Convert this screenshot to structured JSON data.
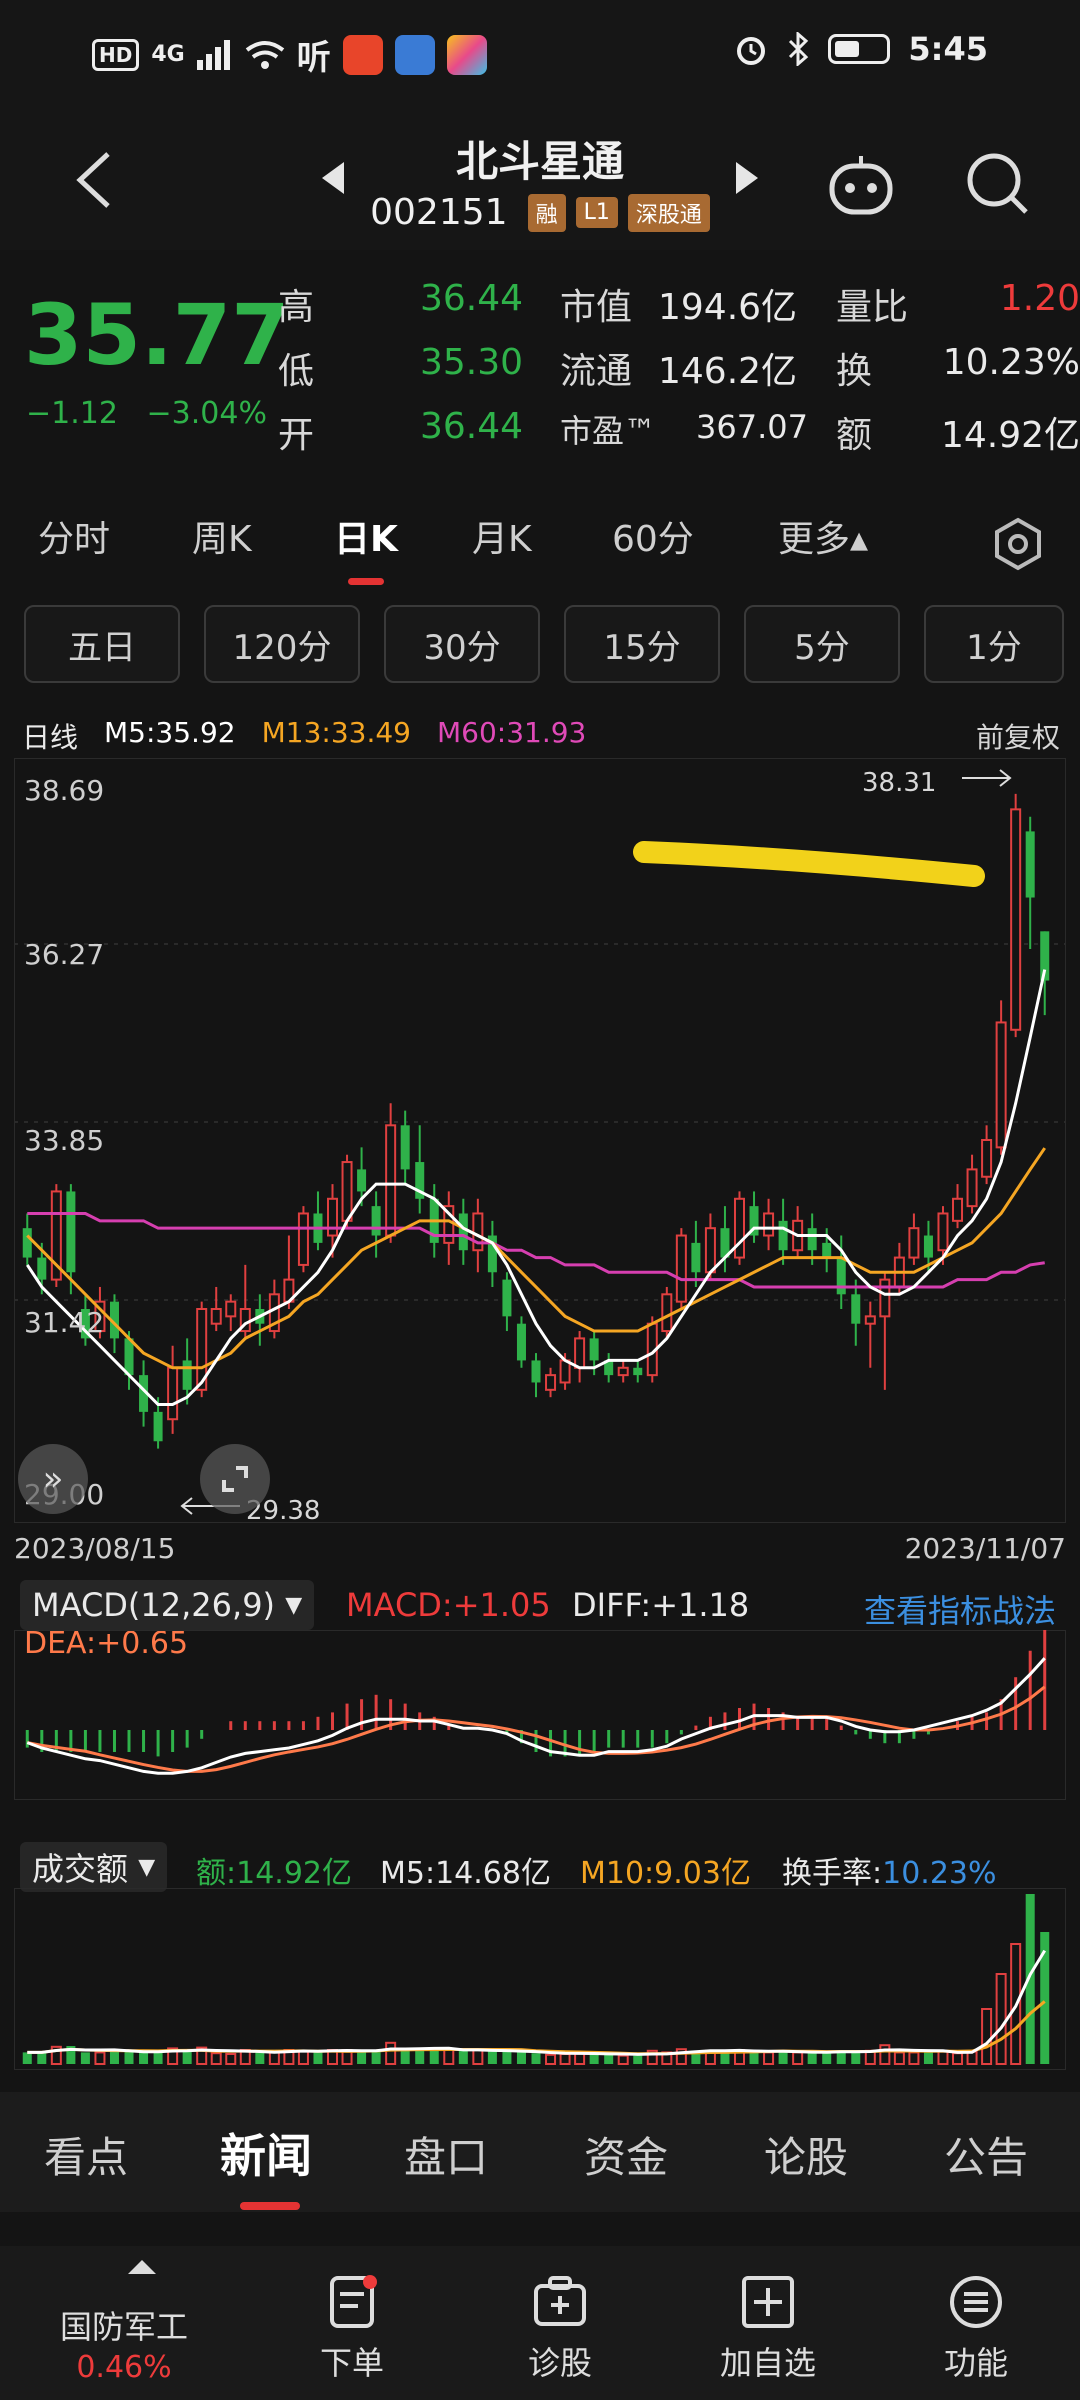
{
  "status": {
    "time": "5:45",
    "hd": "HD",
    "net": "4G",
    "app_hear": "听"
  },
  "header": {
    "title": "北斗星通",
    "code": "002151",
    "tags": [
      "融",
      "L1",
      "深股通"
    ]
  },
  "quote": {
    "price": "35.77",
    "change": "−1.12",
    "change_pct": "−3.04%",
    "rows": [
      {
        "l1": "高",
        "v1": "36.44",
        "l2": "市值",
        "v2": "194.6亿",
        "l3": "量比",
        "v3": "1.20"
      },
      {
        "l1": "低",
        "v1": "35.30",
        "l2": "流通",
        "v2": "146.2亿",
        "l3": "换",
        "v3": "10.23%"
      },
      {
        "l1": "开",
        "v1": "36.44",
        "l2": "市盈™",
        "v2": "367.07",
        "l3": "额",
        "v3": "14.92亿"
      }
    ]
  },
  "ktabs": [
    "分时",
    "周K",
    "日K",
    "月K",
    "60分",
    "更多▴"
  ],
  "mtabs": [
    "五日",
    "120分",
    "30分",
    "15分",
    "5分",
    "1分"
  ],
  "ma": {
    "label": "日线",
    "m5": "M5:35.92",
    "m13": "M13:33.49",
    "m60": "M60:31.93",
    "adjust": "前复权"
  },
  "chart_data": {
    "type": "candlestick",
    "y_ticks": [
      "38.69",
      "36.27",
      "33.85",
      "31.42",
      "29.00"
    ],
    "ylim": [
      29.0,
      38.69
    ],
    "date_start": "2023/08/15",
    "date_end": "2023/11/07",
    "annot_high": "38.31",
    "annot_low": "29.38",
    "colors": {
      "up": "#e04040",
      "down": "#2fb24a",
      "m5": "#ffffff",
      "m13": "#f5a623",
      "m60": "#d63fb0",
      "highlight": "#f2d21a"
    },
    "candles": [
      [
        32.4,
        32.0,
        32.6,
        31.9
      ],
      [
        32.0,
        31.7,
        32.2,
        31.5
      ],
      [
        31.7,
        32.9,
        33.0,
        31.6
      ],
      [
        32.9,
        31.8,
        33.0,
        31.5
      ],
      [
        31.3,
        30.9,
        31.5,
        30.8
      ],
      [
        31.0,
        31.4,
        31.6,
        30.9
      ],
      [
        31.4,
        30.9,
        31.5,
        30.7
      ],
      [
        30.9,
        30.4,
        31.0,
        30.2
      ],
      [
        30.4,
        29.9,
        30.6,
        29.7
      ],
      [
        29.9,
        29.5,
        30.1,
        29.4
      ],
      [
        29.8,
        30.5,
        30.8,
        29.6
      ],
      [
        30.6,
        30.2,
        30.9,
        30.0
      ],
      [
        30.2,
        31.3,
        31.4,
        30.1
      ],
      [
        31.1,
        31.3,
        31.6,
        31.0
      ],
      [
        31.2,
        31.4,
        31.5,
        31.0
      ],
      [
        31.0,
        31.3,
        31.9,
        30.9
      ],
      [
        31.3,
        31.1,
        31.5,
        30.8
      ],
      [
        31.0,
        31.5,
        31.7,
        30.9
      ],
      [
        31.4,
        31.7,
        32.3,
        31.3
      ],
      [
        31.9,
        32.6,
        32.7,
        31.8
      ],
      [
        32.6,
        32.2,
        32.9,
        32.1
      ],
      [
        32.3,
        32.8,
        33.0,
        32.0
      ],
      [
        32.5,
        33.3,
        33.4,
        32.4
      ],
      [
        33.2,
        32.9,
        33.5,
        32.7
      ],
      [
        32.7,
        32.3,
        32.9,
        32.0
      ],
      [
        32.3,
        33.8,
        34.1,
        32.2
      ],
      [
        33.8,
        33.2,
        34.0,
        33.0
      ],
      [
        33.3,
        32.8,
        33.8,
        32.6
      ],
      [
        32.8,
        32.2,
        33.0,
        32.0
      ],
      [
        32.2,
        32.7,
        32.9,
        31.9
      ],
      [
        32.6,
        32.1,
        32.8,
        31.9
      ],
      [
        32.1,
        32.6,
        32.8,
        31.8
      ],
      [
        32.3,
        31.8,
        32.5,
        31.6
      ],
      [
        31.7,
        31.2,
        31.8,
        31.0
      ],
      [
        31.1,
        30.6,
        31.2,
        30.5
      ],
      [
        30.6,
        30.3,
        30.7,
        30.1
      ],
      [
        30.2,
        30.4,
        30.5,
        30.1
      ],
      [
        30.3,
        30.6,
        30.7,
        30.2
      ],
      [
        30.5,
        30.9,
        31.0,
        30.3
      ],
      [
        30.9,
        30.6,
        31.0,
        30.4
      ],
      [
        30.6,
        30.4,
        30.7,
        30.3
      ],
      [
        30.4,
        30.5,
        30.6,
        30.3
      ],
      [
        30.5,
        30.4,
        30.6,
        30.3
      ],
      [
        30.4,
        31.1,
        31.2,
        30.3
      ],
      [
        31.0,
        31.5,
        31.6,
        30.9
      ],
      [
        31.4,
        32.3,
        32.4,
        31.3
      ],
      [
        32.2,
        31.8,
        32.5,
        31.6
      ],
      [
        31.8,
        32.4,
        32.6,
        31.7
      ],
      [
        32.4,
        32.0,
        32.7,
        31.8
      ],
      [
        32.0,
        32.8,
        32.9,
        31.9
      ],
      [
        32.7,
        32.3,
        32.9,
        32.2
      ],
      [
        32.3,
        32.6,
        32.8,
        32.1
      ],
      [
        32.5,
        32.1,
        32.8,
        31.9
      ],
      [
        32.1,
        32.5,
        32.7,
        32.0
      ],
      [
        32.4,
        32.1,
        32.6,
        31.9
      ],
      [
        32.2,
        32.0,
        32.4,
        31.8
      ],
      [
        32.0,
        31.5,
        32.3,
        31.3
      ],
      [
        31.5,
        31.1,
        31.7,
        30.8
      ],
      [
        31.1,
        31.2,
        31.4,
        30.5
      ],
      [
        31.2,
        31.7,
        31.8,
        30.2
      ],
      [
        31.6,
        32.0,
        32.2,
        31.5
      ],
      [
        32.0,
        32.4,
        32.6,
        31.9
      ],
      [
        32.3,
        32.0,
        32.5,
        31.8
      ],
      [
        32.1,
        32.6,
        32.7,
        31.9
      ],
      [
        32.5,
        32.8,
        33.0,
        32.4
      ],
      [
        32.7,
        33.2,
        33.4,
        32.6
      ],
      [
        33.1,
        33.6,
        33.8,
        33.0
      ],
      [
        33.5,
        35.2,
        35.5,
        33.4
      ],
      [
        35.1,
        38.1,
        38.31,
        35.0
      ],
      [
        37.8,
        36.9,
        38.0,
        36.2
      ],
      [
        36.44,
        35.77,
        36.44,
        35.3
      ]
    ],
    "m5": [
      31.9,
      31.6,
      31.4,
      31.2,
      31.0,
      30.8,
      30.6,
      30.4,
      30.2,
      30.0,
      30.0,
      30.1,
      30.3,
      30.6,
      30.9,
      31.1,
      31.2,
      31.3,
      31.4,
      31.6,
      31.8,
      32.1,
      32.5,
      32.8,
      33.0,
      33.0,
      33.0,
      32.9,
      32.8,
      32.6,
      32.4,
      32.3,
      32.2,
      31.9,
      31.5,
      31.1,
      30.8,
      30.6,
      30.5,
      30.5,
      30.6,
      30.6,
      30.6,
      30.7,
      30.9,
      31.2,
      31.5,
      31.8,
      32.0,
      32.2,
      32.4,
      32.4,
      32.4,
      32.3,
      32.3,
      32.3,
      32.1,
      31.8,
      31.6,
      31.5,
      31.5,
      31.6,
      31.8,
      32.0,
      32.3,
      32.5,
      32.8,
      33.3,
      34.1,
      35.0,
      35.92
    ],
    "m13": [
      32.3,
      32.1,
      31.9,
      31.7,
      31.5,
      31.3,
      31.1,
      30.9,
      30.7,
      30.6,
      30.5,
      30.5,
      30.5,
      30.6,
      30.7,
      30.9,
      31.0,
      31.1,
      31.2,
      31.4,
      31.5,
      31.7,
      31.9,
      32.1,
      32.2,
      32.3,
      32.4,
      32.5,
      32.5,
      32.5,
      32.4,
      32.3,
      32.2,
      32.0,
      31.8,
      31.6,
      31.4,
      31.2,
      31.1,
      31.0,
      31.0,
      31.0,
      31.0,
      31.1,
      31.2,
      31.3,
      31.4,
      31.5,
      31.6,
      31.7,
      31.8,
      31.9,
      32.0,
      32.0,
      32.0,
      32.0,
      32.0,
      31.9,
      31.8,
      31.8,
      31.8,
      31.8,
      31.9,
      32.0,
      32.1,
      32.2,
      32.4,
      32.6,
      32.9,
      33.2,
      33.49
    ],
    "m60": [
      32.6,
      32.6,
      32.6,
      32.6,
      32.6,
      32.5,
      32.5,
      32.5,
      32.5,
      32.4,
      32.4,
      32.4,
      32.4,
      32.4,
      32.4,
      32.4,
      32.4,
      32.4,
      32.4,
      32.4,
      32.4,
      32.4,
      32.4,
      32.4,
      32.4,
      32.4,
      32.4,
      32.4,
      32.3,
      32.3,
      32.3,
      32.2,
      32.2,
      32.1,
      32.1,
      32.0,
      32.0,
      31.9,
      31.9,
      31.9,
      31.8,
      31.8,
      31.8,
      31.8,
      31.8,
      31.7,
      31.7,
      31.7,
      31.7,
      31.7,
      31.6,
      31.6,
      31.6,
      31.6,
      31.6,
      31.6,
      31.6,
      31.6,
      31.6,
      31.6,
      31.6,
      31.6,
      31.6,
      31.6,
      31.7,
      31.7,
      31.7,
      31.8,
      31.8,
      31.9,
      31.93
    ]
  },
  "macd": {
    "select": "MACD(12,26,9)",
    "macd": "MACD:+1.05",
    "diff": "DIFF:+1.18",
    "dea": "DEA:+0.65",
    "link": "查看指标战法"
  },
  "vol": {
    "select": "成交额",
    "amount": "额:14.92亿",
    "m5": "M5:14.68亿",
    "m10": "M10:9.03亿",
    "turn_label": "换手率:",
    "turn_val": "10.23%"
  },
  "btabs": [
    "看点",
    "新闻",
    "盘口",
    "资金",
    "论股",
    "公告"
  ],
  "nav": {
    "sector": "国防军工",
    "sector_val": "0.46%",
    "items": [
      "下单",
      "诊股",
      "加自选",
      "功能"
    ]
  }
}
